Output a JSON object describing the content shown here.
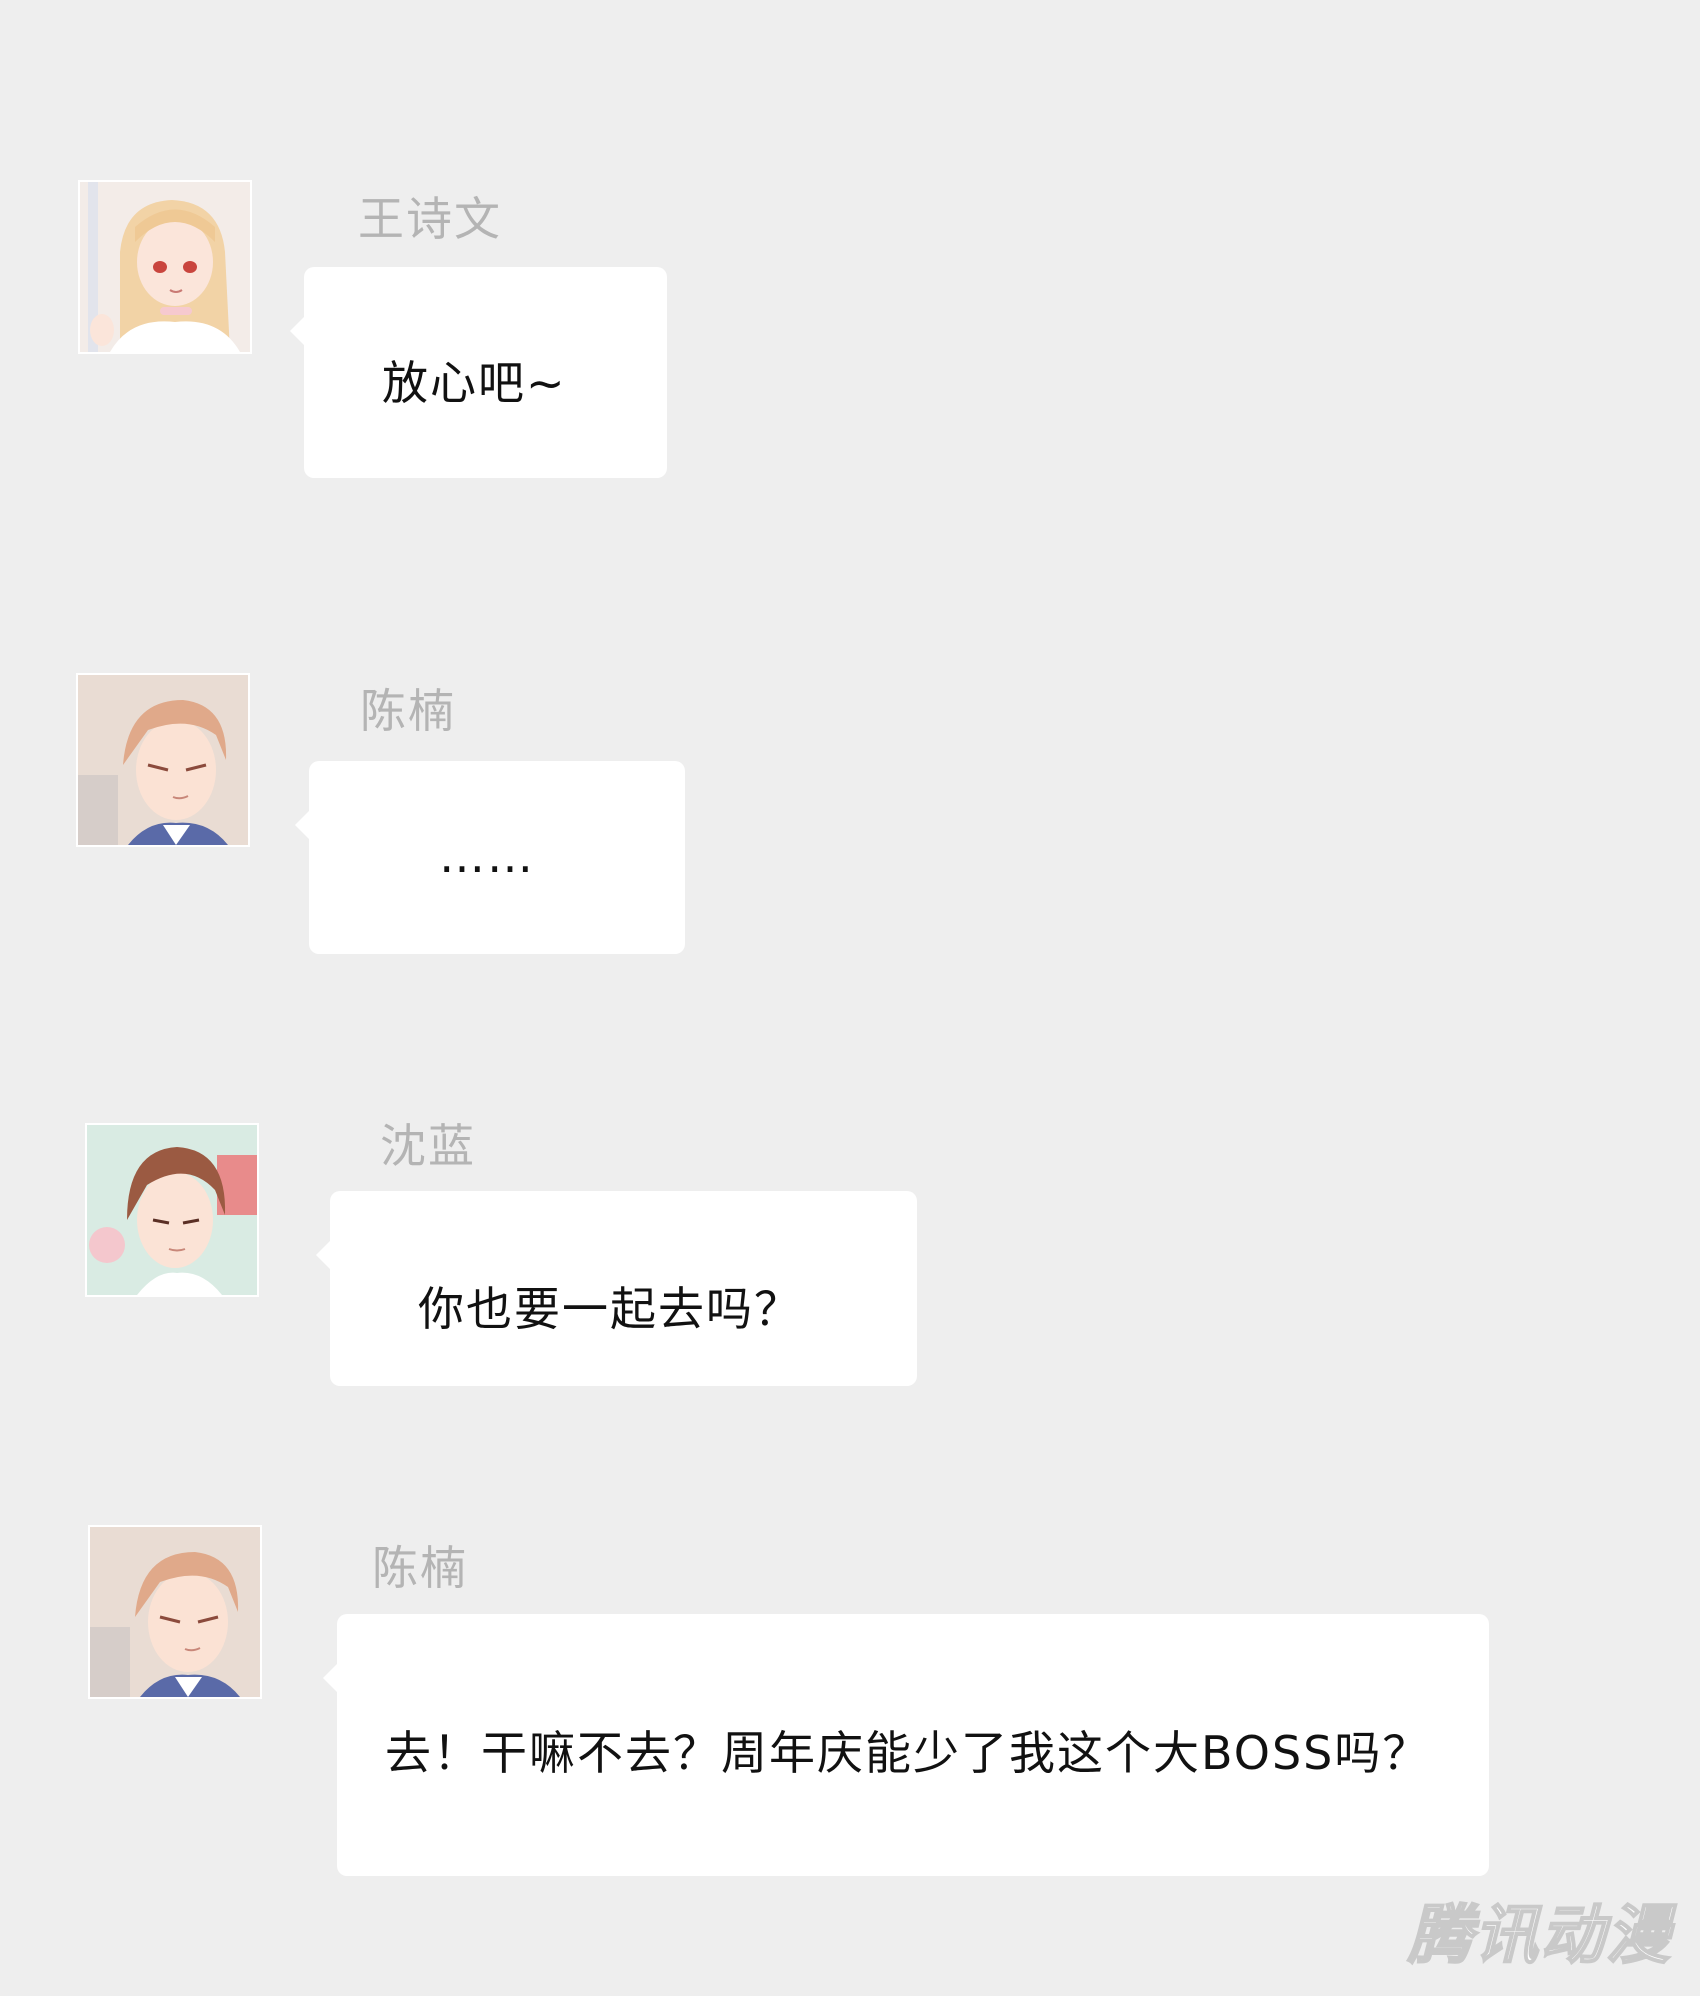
{
  "messages": [
    {
      "sender": "王诗文",
      "text": "放心吧~",
      "avatar_icon": "blonde-girl-avatar-icon"
    },
    {
      "sender": "陈楠",
      "text": "……",
      "avatar_icon": "auburn-man-avatar-icon"
    },
    {
      "sender": "沈蓝",
      "text": "你也要一起去吗？",
      "avatar_icon": "brown-hair-man-avatar-icon"
    },
    {
      "sender": "陈楠",
      "text": "去！干嘛不去？周年庆能少了我这个大BOSS吗？",
      "avatar_icon": "auburn-man-avatar-icon"
    }
  ],
  "watermark": "腾讯动漫",
  "colors": {
    "background": "#eeeeee",
    "bubble": "#ffffff",
    "sender_name": "#b4b4b4",
    "message_text": "#111111"
  }
}
